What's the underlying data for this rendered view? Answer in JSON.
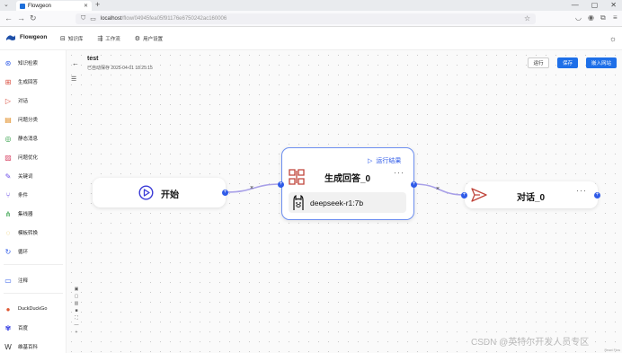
{
  "browser": {
    "tab_title": "Flowgeon",
    "url_host": "localhost",
    "url_path": "/flow/04945fea05f91176e6750242ac160006"
  },
  "app": {
    "brand": "Flowgeon",
    "nav": [
      {
        "label": "知识库",
        "icon": "knowledge-base-icon"
      },
      {
        "label": "工作流",
        "icon": "workflow-icon"
      },
      {
        "label": "用户设置",
        "icon": "gear-icon"
      }
    ]
  },
  "sidebar": {
    "items": [
      {
        "label": "知识检索",
        "icon": "retrieval-icon",
        "color": "#2f5be8"
      },
      {
        "label": "生成回答",
        "icon": "generate-icon",
        "color": "#d94a3a"
      },
      {
        "label": "对话",
        "icon": "chat-send-icon",
        "color": "#d94a3a"
      },
      {
        "label": "问题分类",
        "icon": "classify-icon",
        "color": "#e08a1e"
      },
      {
        "label": "静态消息",
        "icon": "message-icon",
        "color": "#2f9e44"
      },
      {
        "label": "问题优化",
        "icon": "optimize-icon",
        "color": "#d94a6a"
      },
      {
        "label": "关键词",
        "icon": "keyword-icon",
        "color": "#6a4be8"
      },
      {
        "label": "条件",
        "icon": "condition-icon",
        "color": "#6a4be8"
      },
      {
        "label": "集线器",
        "icon": "hub-icon",
        "color": "#2f9e44"
      },
      {
        "label": "模板转换",
        "icon": "template-icon",
        "color": "#e0b21e"
      },
      {
        "label": "循环",
        "icon": "loop-icon",
        "color": "#2f5be8"
      },
      {
        "label": "注释",
        "icon": "note-icon",
        "color": "#2f5be8"
      },
      {
        "label": "DuckDuckGo",
        "icon": "duckduckgo-icon",
        "color": "#de5833"
      },
      {
        "label": "百度",
        "icon": "baidu-icon",
        "color": "#2932e1"
      },
      {
        "label": "维基百科",
        "icon": "wikipedia-icon",
        "color": "#333333"
      }
    ]
  },
  "flow": {
    "name": "test",
    "saved_text": "已自动保存 2025-04-01 18:25:15",
    "buttons": {
      "run": "运行",
      "save": "保存",
      "embed": "嵌入网站"
    }
  },
  "nodes": {
    "start": {
      "title": "开始"
    },
    "generate": {
      "title": "生成回答_0",
      "run_result": "运行结果",
      "model": "deepseek-r1:7b",
      "more": "···"
    },
    "chat": {
      "title": "对话_0",
      "more": "···"
    }
  },
  "canvas_controls": [
    "zoom-in",
    "zoom-out",
    "fit-view",
    "lock",
    "fullscreen",
    "minus",
    "plus"
  ],
  "watermark": "CSDN @英特尔开发人员专区",
  "footer_credit": "React Flow",
  "colors": {
    "primary": "#1e6fe8",
    "edge": "#a8a0e8",
    "port": "#2f5be8",
    "node_border_active": "#6d8ff0"
  }
}
